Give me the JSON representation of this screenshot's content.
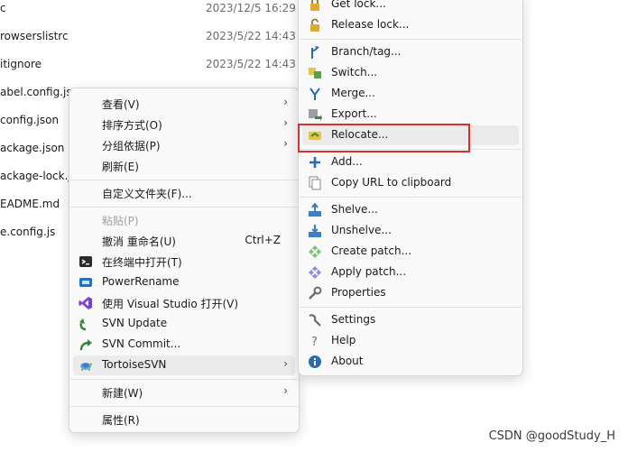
{
  "files": [
    {
      "name": "c",
      "date": "2023/12/5 16:29"
    },
    {
      "name": "rowserslistrc",
      "date": "2023/5/22 14:43"
    },
    {
      "name": "itignore",
      "date": "2023/5/22 14:43"
    },
    {
      "name": "abel.config.js",
      "date": ""
    },
    {
      "name": "config.json",
      "date": ""
    },
    {
      "name": "ackage.json",
      "date": ""
    },
    {
      "name": "ackage-lock.js",
      "date": ""
    },
    {
      "name": "EADME.md",
      "date": ""
    },
    {
      "name": "e.config.js",
      "date": ""
    }
  ],
  "main_menu": {
    "view": "查看(V)",
    "sort": "排序方式(O)",
    "group": "分组依据(P)",
    "refresh": "刷新(E)",
    "customize": "自定义文件夹(F)...",
    "paste": "粘贴(P)",
    "undo": "撤消 重命名(U)",
    "undo_shortcut": "Ctrl+Z",
    "terminal": "在终端中打开(T)",
    "powerrename": "PowerRename",
    "visual_studio": "使用 Visual Studio 打开(V)",
    "svn_update": "SVN Update",
    "svn_commit": "SVN Commit...",
    "tortoise": "TortoiseSVN",
    "new": "新建(W)",
    "properties": "属性(R)"
  },
  "sub_menu": {
    "get_lock": "Get lock...",
    "release_lock": "Release lock...",
    "branch_tag": "Branch/tag...",
    "switch": "Switch...",
    "merge": "Merge...",
    "export": "Export...",
    "relocate": "Relocate...",
    "add": "Add...",
    "copy_url": "Copy URL to clipboard",
    "shelve": "Shelve...",
    "unshelve": "Unshelve...",
    "create_patch": "Create patch...",
    "apply_patch": "Apply patch...",
    "properties": "Properties",
    "settings": "Settings",
    "help": "Help",
    "about": "About"
  },
  "watermark": "CSDN @goodStudy_H",
  "colors": {
    "highlight_box": "#d9302f",
    "menu_bg": "#f9f9f9",
    "hover_bg": "#ebebeb"
  },
  "icons": {
    "arrow": "›"
  }
}
